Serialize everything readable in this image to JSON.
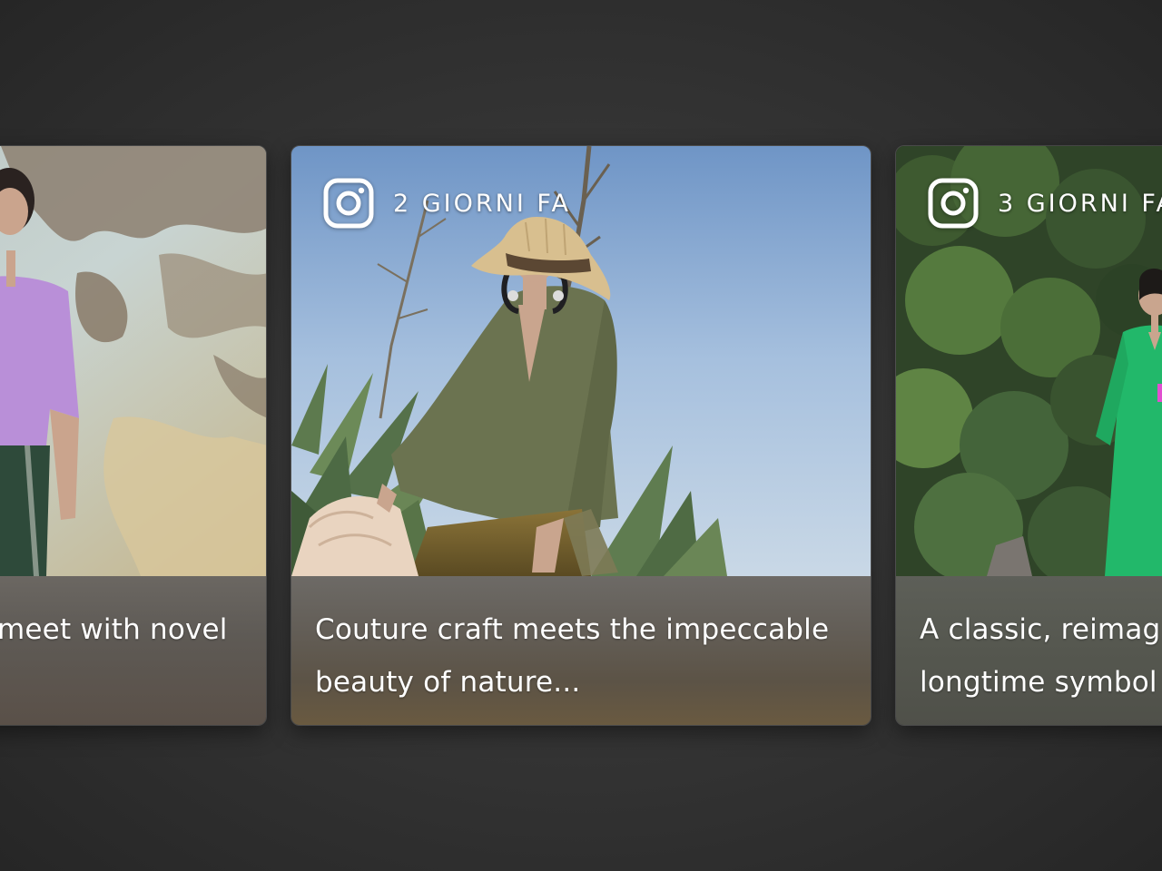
{
  "carousel": {
    "cards": [
      {
        "source_icon": "instagram-icon",
        "time_label": "",
        "caption": "meet with novel"
      },
      {
        "source_icon": "instagram-icon",
        "time_label": "2 GIORNI FA",
        "caption_line1": "Couture craft meets the impeccable",
        "caption_line2": "beauty of nature..."
      },
      {
        "source_icon": "instagram-icon",
        "time_label": "3 GIORNI FA",
        "caption_line1": "A classic, reimag",
        "caption_line2": "longtime symbol"
      }
    ]
  },
  "colors": {
    "background": "#353535",
    "text": "#ffffff"
  }
}
